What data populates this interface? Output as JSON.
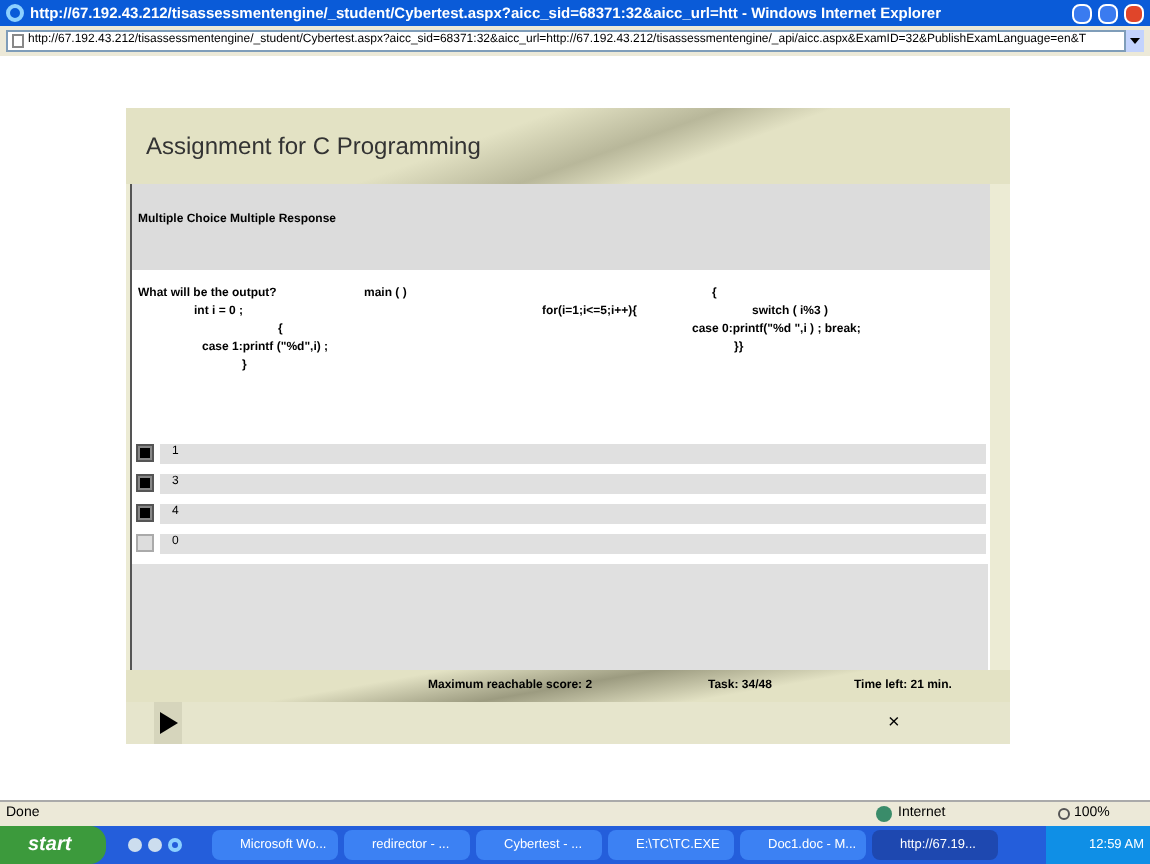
{
  "window": {
    "title": "http://67.192.43.212/tisassessmentengine/_student/Cybertest.aspx?aicc_sid=68371:32&aicc_url=htt - Windows Internet Explorer"
  },
  "address_bar": {
    "value": "http://67.192.43.212/tisassessmentengine/_student/Cybertest.aspx?aicc_sid=68371:32&aicc_url=http://67.192.43.212/tisassessmentengine/_api/aicc.aspx&ExamID=32&PublishExamLanguage=en&T"
  },
  "assignment": {
    "title": "Assignment for C Programming",
    "question_type": "Multiple Choice Multiple Response",
    "question_lines": [
      {
        "column_1": "What will be the output?",
        "column_2": "main ( )",
        "column_4": "{"
      },
      {
        "column_1": "int i = 0 ;",
        "column_3": "for(i=1;i<=5;i++){",
        "column_4": "switch ( i%3 )"
      },
      {
        "column_1": "{",
        "column_4": "case 0:printf(\"%d \",i ) ; break;"
      },
      {
        "column_1": "case 1:printf (\"%d\",i) ;",
        "column_4": "}}"
      },
      {
        "column_1": "}"
      }
    ],
    "options": [
      {
        "label": "1",
        "checked": true
      },
      {
        "label": "3",
        "checked": true
      },
      {
        "label": "4",
        "checked": true
      },
      {
        "label": "0",
        "checked": false
      }
    ],
    "footer": {
      "score": "Maximum reachable score: 2",
      "task": "Task: 34/48",
      "time_left": "Time left: 21 min."
    },
    "close_button": "×"
  },
  "status_bar": {
    "status": "Done",
    "zone": "Internet",
    "zoom": "100%"
  },
  "taskbar": {
    "start": "start",
    "tasks": [
      {
        "label": "Microsoft Wo...",
        "selected": false
      },
      {
        "label": "redirector - ...",
        "selected": false
      },
      {
        "label": "Cybertest - ...",
        "selected": false
      },
      {
        "label": "E:\\TC\\TC.EXE",
        "selected": false
      },
      {
        "label": "Doc1.doc - M...",
        "selected": false
      },
      {
        "label": "http://67.19...",
        "selected": true
      }
    ],
    "clock": "12:59 AM"
  }
}
